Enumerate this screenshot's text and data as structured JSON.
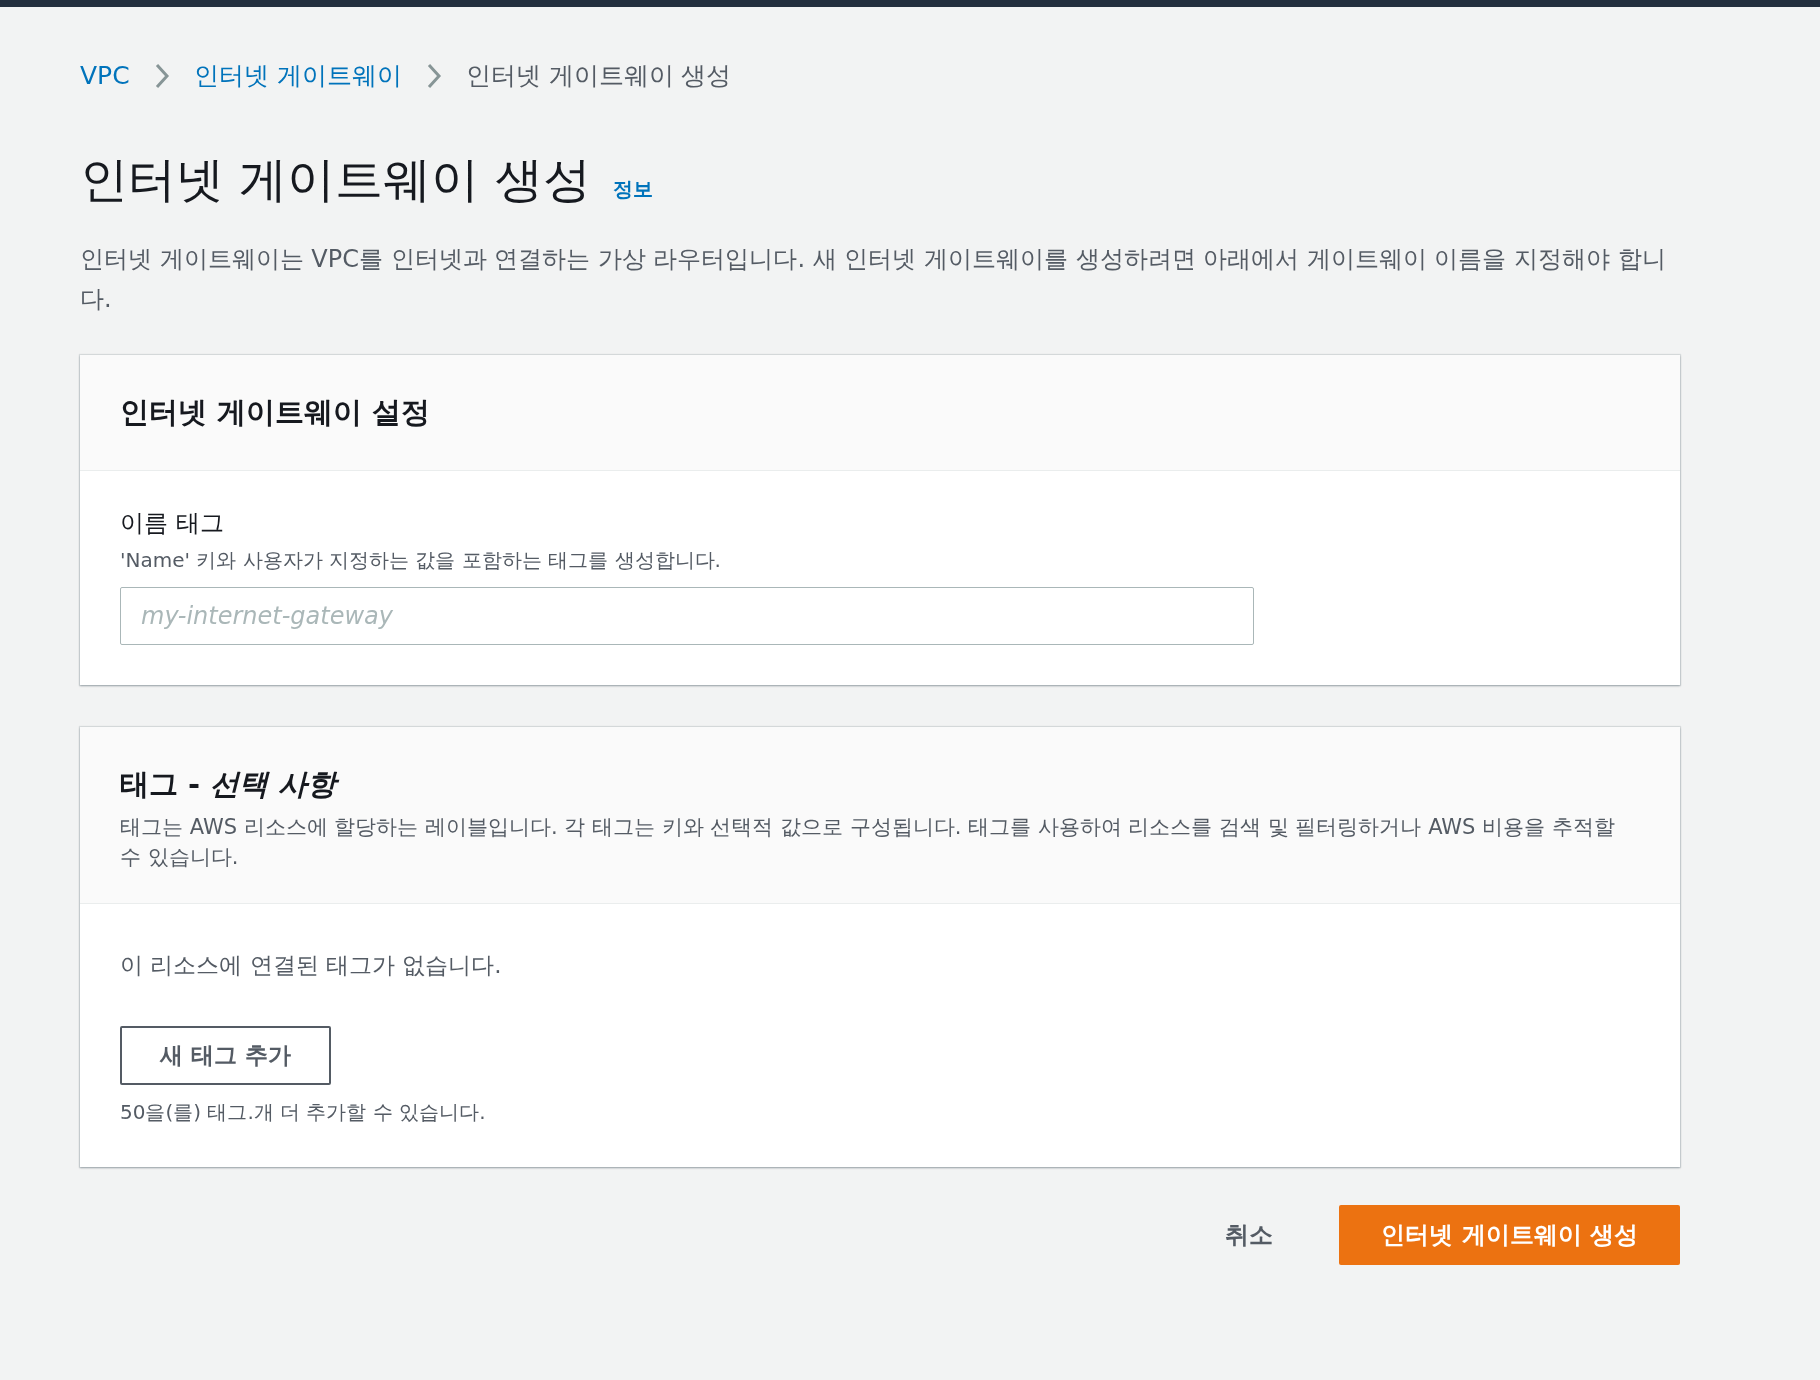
{
  "breadcrumb": [
    {
      "label": "VPC",
      "kind": "link"
    },
    {
      "label": "인터넷 게이트웨이",
      "kind": "link"
    },
    {
      "label": "인터넷 게이트웨이 생성",
      "kind": "current"
    }
  ],
  "page": {
    "title": "인터넷 게이트웨이 생성",
    "info_link": "정보",
    "description": "인터넷 게이트웨이는 VPC를 인터넷과 연결하는 가상 라우터입니다. 새 인터넷 게이트웨이를 생성하려면 아래에서 게이트웨이 이름을 지정해야 합니다."
  },
  "settings_panel": {
    "title": "인터넷 게이트웨이 설정",
    "field": {
      "label": "이름 태그",
      "hint": "'Name' 키와 사용자가 지정하는 값을 포함하는 태그를 생성합니다.",
      "placeholder": "my-internet-gateway"
    }
  },
  "tags_panel": {
    "title": "태그 - *선택 사항*",
    "description": "태그는 AWS 리소스에 할당하는 레이블입니다. 각 태그는 키와 선택적 값으로 구성됩니다. 태그를 사용하여 리소스를 검색 및 필터링하거나 AWS 비용을 추적할 수 있습니다.",
    "empty_text": "이 리소스에 연결된 태그가 없습니다.",
    "add_button": "새 태그 추가",
    "limit_text": "50을(를) 태그.개 더 추가할 수 있습니다."
  },
  "footer": {
    "cancel": "취소",
    "submit": "인터넷 게이트웨이 생성"
  }
}
